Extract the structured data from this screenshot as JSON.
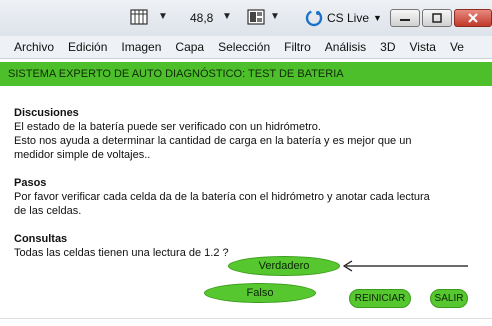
{
  "toolbar": {
    "zoom_value": "48,8",
    "cs_live_label": "CS Live",
    "window_controls": [
      "minimize-icon",
      "restore-icon",
      "close-icon"
    ]
  },
  "menu": {
    "items": [
      "Archivo",
      "Edición",
      "Imagen",
      "Capa",
      "Selección",
      "Filtro",
      "Análisis",
      "3D",
      "Vista",
      "Ve"
    ]
  },
  "document": {
    "header": "SISTEMA EXPERTO DE AUTO DIAGNÓSTICO: TEST DE BATERIA",
    "sections": [
      {
        "title": "Discusiones",
        "lines": [
          "El estado de la batería puede ser verificado con un hidrómetro.",
          "Esto nos ayuda a determinar la cantidad de carga en la batería y es mejor que un",
          "medidor simple de voltajes.."
        ]
      },
      {
        "title": "Pasos",
        "lines": [
          "Por favor verificar cada celda da de la batería con el hidrómetro y anotar cada lectura",
          "de las celdas."
        ]
      },
      {
        "title": "Consultas",
        "lines": [
          "Todas las celdas tienen una lectura de 1.2 ?"
        ]
      }
    ],
    "buttons": {
      "true_label": "Verdadero",
      "false_label": "Falso",
      "reset_label": "REINICIAR",
      "exit_label": "SALIR"
    }
  },
  "colors": {
    "accent_green": "#4cbf2a",
    "button_green": "#56c72f"
  }
}
